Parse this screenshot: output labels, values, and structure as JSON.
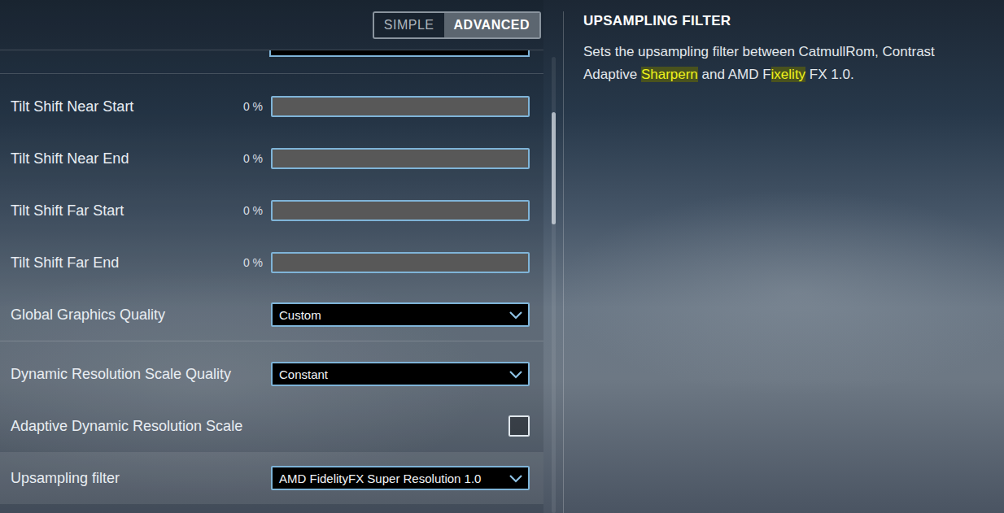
{
  "view_toggle": [
    {
      "label": "SIMPLE",
      "selected": false
    },
    {
      "label": "ADVANCED",
      "selected": true
    }
  ],
  "sections": [
    {
      "rows": [
        {
          "kind": "slider",
          "label": "Tilt Shift Near Start",
          "reading": "0 %",
          "level": 0,
          "selected": false
        },
        {
          "kind": "slider",
          "label": "Tilt Shift Near End",
          "reading": "0 %",
          "level": 0,
          "selected": false
        },
        {
          "kind": "slider",
          "label": "Tilt Shift Far Start",
          "reading": "0 %",
          "level": 0,
          "selected": false
        },
        {
          "kind": "slider",
          "label": "Tilt Shift Far End",
          "reading": "0 %",
          "level": 0,
          "selected": false
        },
        {
          "kind": "dropdown",
          "label": "Global Graphics Quality",
          "value": "Custom",
          "selected": false
        }
      ]
    },
    {
      "rows": [
        {
          "kind": "dropdown",
          "label": "Dynamic Resolution Scale Quality",
          "value": "Constant",
          "selected": false
        },
        {
          "kind": "checkbox",
          "label": "Adaptive Dynamic Resolution Scale",
          "checked": false,
          "selected": false
        },
        {
          "kind": "dropdown",
          "label": "Upsampling filter",
          "value": "AMD FidelityFX Super Resolution 1.0",
          "selected": true
        }
      ]
    }
  ],
  "help": {
    "title": "UPSAMPLING FILTER",
    "description": [
      {
        "text": "Sets the upsampling filter between CatmullRom, Contrast Adaptive ",
        "highlighted": false
      },
      {
        "text": "Sharpern",
        "highlighted": true
      },
      {
        "text": " and AMD F",
        "highlighted": false
      },
      {
        "text": "ixelity",
        "highlighted": true
      },
      {
        "text": " FX 1.0.",
        "highlighted": false
      }
    ]
  }
}
